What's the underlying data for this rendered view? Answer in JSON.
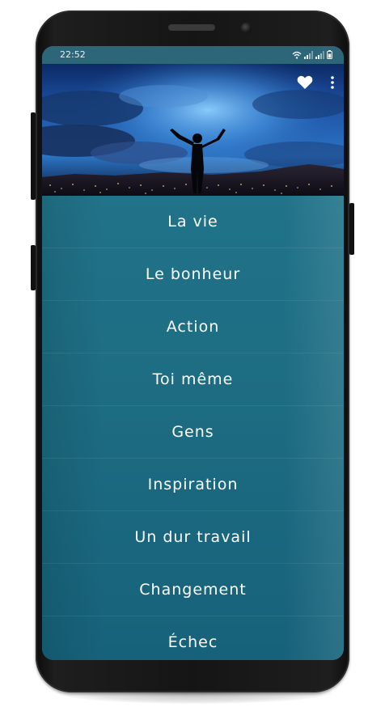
{
  "status_bar": {
    "time": "22:52",
    "icons": [
      "wifi-icon",
      "signal-icon",
      "signal-icon",
      "battery-icon"
    ]
  },
  "header": {
    "actions": [
      "heart-icon",
      "more-vertical-icon"
    ]
  },
  "menu": {
    "items": [
      {
        "label": "La vie"
      },
      {
        "label": "Le bonheur"
      },
      {
        "label": "Action"
      },
      {
        "label": "Toi même"
      },
      {
        "label": "Gens"
      },
      {
        "label": "Inspiration"
      },
      {
        "label": "Un dur travail"
      },
      {
        "label": "Changement"
      },
      {
        "label": "Échec"
      }
    ]
  },
  "colors": {
    "list_background": "#1c6b81",
    "status_bar": "#2d6678",
    "text": "#ffffff",
    "phone_body": "#151515"
  }
}
